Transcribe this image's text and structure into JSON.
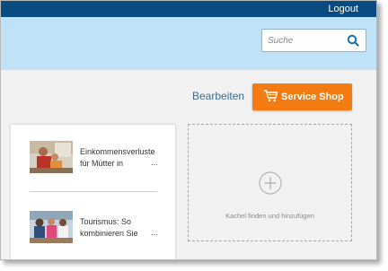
{
  "header": {
    "logout_label": "Logout",
    "search_placeholder": "Suche"
  },
  "toolbar": {
    "edit_label": "Bearbeiten",
    "service_shop_label": "Service Shop"
  },
  "news": {
    "items": [
      {
        "title": "Einkommensverluste für Mütter in",
        "more": "..."
      },
      {
        "title": "Tourismus: So kombinieren Sie",
        "more": "..."
      }
    ]
  },
  "add_tile": {
    "label": "Kachel finden und hinzufügen"
  },
  "icons": {
    "search": "search-icon",
    "cart": "cart-icon",
    "plus": "plus-circle-icon"
  },
  "colors": {
    "topbar": "#0a4c81",
    "header": "#bfe2f7",
    "accent": "#f47b12",
    "link": "#3a6d95"
  }
}
